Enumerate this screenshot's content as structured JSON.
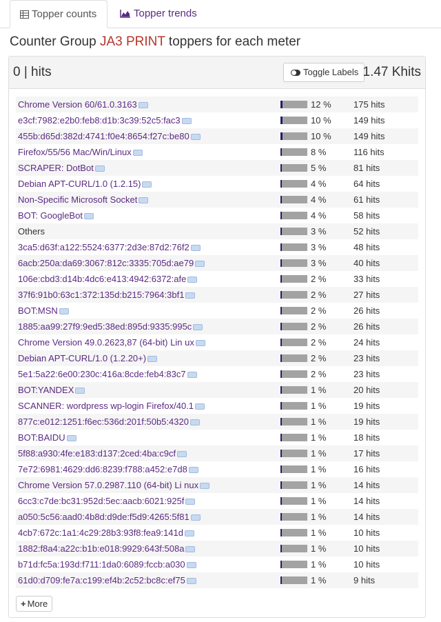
{
  "tabs": [
    {
      "label": "Topper counts",
      "icon": "table-icon"
    },
    {
      "label": "Topper trends",
      "icon": "area-chart-icon"
    }
  ],
  "heading": {
    "prefix": "Counter Group ",
    "group": "JA3 PRINT",
    "suffix": " toppers for each meter"
  },
  "panel": {
    "left": "0 | hits",
    "toggle_label": "Toggle Labels",
    "total": "1.47 Khits"
  },
  "colors": {
    "link": "#5a2a82",
    "group_name": "#b5352a",
    "bar_fill": "#1f1f6e",
    "bar_bg": "#a3a3a3"
  },
  "rows": [
    {
      "name": "Chrome Version 60/61.0.3163",
      "pct": "12 %",
      "frac": 0.12,
      "hits": "175 hits",
      "link": true
    },
    {
      "name": "e3cf:7982:e2b0:feb8:d1b:3c39:52c5:fac3",
      "pct": "10 %",
      "frac": 0.1,
      "hits": "149 hits",
      "link": true
    },
    {
      "name": "455b:d65d:382d:4741:f0e4:8654:f27c:be80",
      "pct": "10 %",
      "frac": 0.1,
      "hits": "149 hits",
      "link": true
    },
    {
      "name": "Firefox/55/56 Mac/Win/Linux",
      "pct": "8 %",
      "frac": 0.08,
      "hits": "116 hits",
      "link": true
    },
    {
      "name": "SCRAPER: DotBot",
      "pct": "5 %",
      "frac": 0.05,
      "hits": "81 hits",
      "link": true
    },
    {
      "name": "Debian APT-CURL/1.0 (1.2.15)",
      "pct": "4 %",
      "frac": 0.04,
      "hits": "64 hits",
      "link": true
    },
    {
      "name": "Non-Specific Microsoft Socket",
      "pct": "4 %",
      "frac": 0.04,
      "hits": "61 hits",
      "link": true
    },
    {
      "name": "BOT: GoogleBot",
      "pct": "4 %",
      "frac": 0.04,
      "hits": "58 hits",
      "link": true
    },
    {
      "name": "Others",
      "pct": "3 %",
      "frac": 0.03,
      "hits": "52 hits",
      "link": false
    },
    {
      "name": "3ca5:d63f:a122:5524:6377:2d3e:87d2:76f2",
      "pct": "3 %",
      "frac": 0.03,
      "hits": "48 hits",
      "link": true
    },
    {
      "name": "6acb:250a:da69:3067:812c:3335:705d:ae79",
      "pct": "3 %",
      "frac": 0.03,
      "hits": "40 hits",
      "link": true
    },
    {
      "name": "106e:cbd3:d14b:4dc6:e413:4942:6372:afe",
      "pct": "2 %",
      "frac": 0.02,
      "hits": "33 hits",
      "link": true
    },
    {
      "name": "37f6:91b0:63c1:372:135d:b215:7964:3bf1",
      "pct": "2 %",
      "frac": 0.02,
      "hits": "27 hits",
      "link": true
    },
    {
      "name": "BOT:MSN",
      "pct": "2 %",
      "frac": 0.02,
      "hits": "26 hits",
      "link": true
    },
    {
      "name": "1885:aa99:27f9:9ed5:38ed:895d:9335:995c",
      "pct": "2 %",
      "frac": 0.02,
      "hits": "26 hits",
      "link": true
    },
    {
      "name": "Chrome Version 49.0.2623,87 (64-bit) Lin ux",
      "pct": "2 %",
      "frac": 0.02,
      "hits": "24 hits",
      "link": true
    },
    {
      "name": "Debian APT-CURL/1.0 (1.2.20+)",
      "pct": "2 %",
      "frac": 0.02,
      "hits": "23 hits",
      "link": true
    },
    {
      "name": "5e1:5a22:6e00:230c:416a:8cde:feb4:83c7",
      "pct": "2 %",
      "frac": 0.02,
      "hits": "23 hits",
      "link": true
    },
    {
      "name": "BOT:YANDEX",
      "pct": "1 %",
      "frac": 0.01,
      "hits": "20 hits",
      "link": true
    },
    {
      "name": "SCANNER: wordpress wp-login Firefox/40.1",
      "pct": "1 %",
      "frac": 0.01,
      "hits": "19 hits",
      "link": true
    },
    {
      "name": "877c:e012:1251:f6ec:536d:201f:50b5:4320",
      "pct": "1 %",
      "frac": 0.01,
      "hits": "19 hits",
      "link": true
    },
    {
      "name": "BOT:BAIDU",
      "pct": "1 %",
      "frac": 0.01,
      "hits": "18 hits",
      "link": true
    },
    {
      "name": "5f88:a930:4fe:e183:d137:2ced:4ba:c9cf",
      "pct": "1 %",
      "frac": 0.01,
      "hits": "17 hits",
      "link": true
    },
    {
      "name": "7e72:6981:4629:dd6:8239:f788:a452:e7d8",
      "pct": "1 %",
      "frac": 0.01,
      "hits": "16 hits",
      "link": true
    },
    {
      "name": "Chrome Version 57.0.2987.110 (64-bit) Li nux",
      "pct": "1 %",
      "frac": 0.01,
      "hits": "14 hits",
      "link": true
    },
    {
      "name": "6cc3:c7de:bc31:952d:5ec:aacb:6021:925f",
      "pct": "1 %",
      "frac": 0.01,
      "hits": "14 hits",
      "link": true
    },
    {
      "name": "a050:5c56:aad0:4b8d:d9de:f5d9:4265:5f81",
      "pct": "1 %",
      "frac": 0.01,
      "hits": "14 hits",
      "link": true
    },
    {
      "name": "4cb7:672c:1a1:4c29:28b3:93f8:fea9:141d",
      "pct": "1 %",
      "frac": 0.01,
      "hits": "10 hits",
      "link": true
    },
    {
      "name": "1882:f8a4:a22c:b1b:e018:9929:643f:508a",
      "pct": "1 %",
      "frac": 0.01,
      "hits": "10 hits",
      "link": true
    },
    {
      "name": "b71d:fc5a:193d:f711:1da0:6089:fccb:a030",
      "pct": "1 %",
      "frac": 0.01,
      "hits": "10 hits",
      "link": true
    },
    {
      "name": "61d0:d709:fe7a:c199:ef4b:2c52:bc8c:ef75",
      "pct": "1 %",
      "frac": 0.01,
      "hits": "9 hits",
      "link": true
    }
  ],
  "more_label": "More"
}
